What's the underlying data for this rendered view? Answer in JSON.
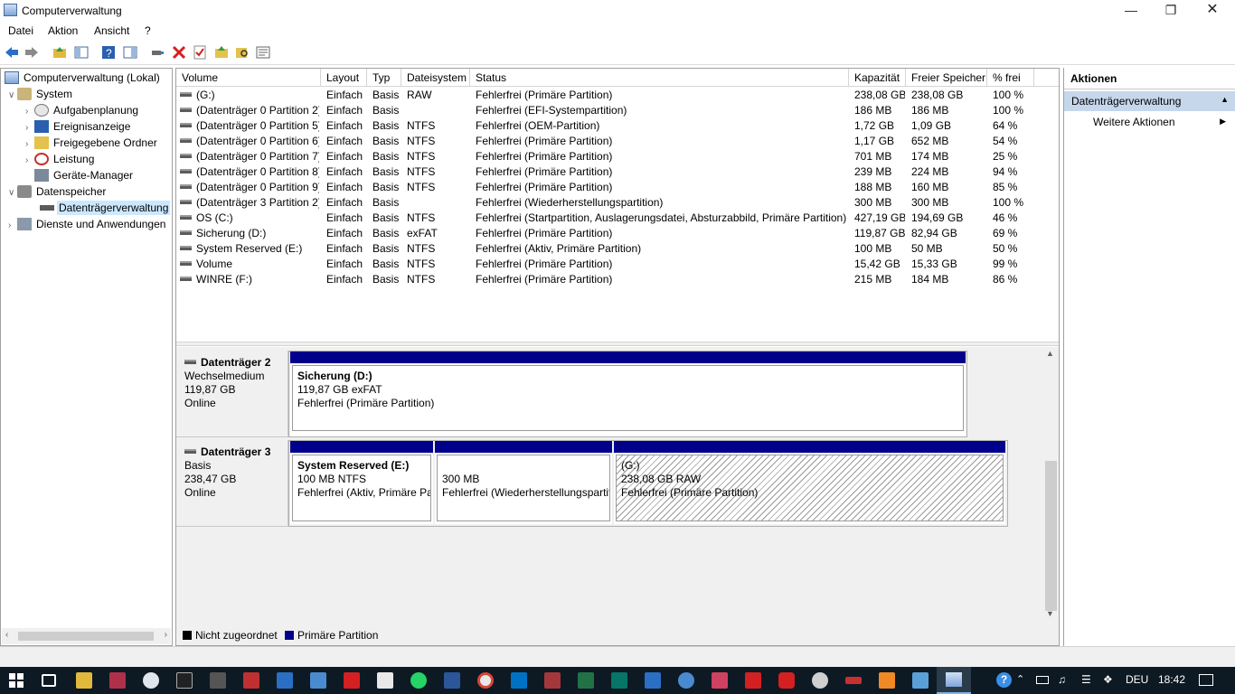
{
  "window": {
    "title": "Computerverwaltung"
  },
  "menu": [
    "Datei",
    "Aktion",
    "Ansicht",
    "?"
  ],
  "toolbar_icons": [
    "back-arrow-icon",
    "forward-arrow-icon",
    "up-folder-icon",
    "show-hide-tree-icon",
    "help-icon",
    "console-icon",
    "connect-icon",
    "delete-icon",
    "properties-icon",
    "folder-icon",
    "search-icon",
    "list-icon"
  ],
  "tree": {
    "root": "Computerverwaltung (Lokal)",
    "system": "System",
    "system_items": [
      "Aufgabenplanung",
      "Ereignisanzeige",
      "Freigegebene Ordner",
      "Leistung",
      "Geräte-Manager"
    ],
    "storage": "Datenspeicher",
    "storage_items": [
      "Datenträgerverwaltung"
    ],
    "services": "Dienste und Anwendungen"
  },
  "list": {
    "columns": [
      "Volume",
      "Layout",
      "Typ",
      "Dateisystem",
      "Status",
      "Kapazität",
      "Freier Speicher",
      "% frei"
    ],
    "rows": [
      [
        "(G:)",
        "Einfach",
        "Basis",
        "RAW",
        "Fehlerfrei (Primäre Partition)",
        "238,08 GB",
        "238,08 GB",
        "100 %"
      ],
      [
        "(Datenträger 0 Partition 2)",
        "Einfach",
        "Basis",
        "",
        "Fehlerfrei (EFI-Systempartition)",
        "186 MB",
        "186 MB",
        "100 %"
      ],
      [
        "(Datenträger 0 Partition 5)",
        "Einfach",
        "Basis",
        "NTFS",
        "Fehlerfrei (OEM-Partition)",
        "1,72 GB",
        "1,09 GB",
        "64 %"
      ],
      [
        "(Datenträger 0 Partition 6)",
        "Einfach",
        "Basis",
        "NTFS",
        "Fehlerfrei (Primäre Partition)",
        "1,17 GB",
        "652 MB",
        "54 %"
      ],
      [
        "(Datenträger 0 Partition 7)",
        "Einfach",
        "Basis",
        "NTFS",
        "Fehlerfrei (Primäre Partition)",
        "701 MB",
        "174 MB",
        "25 %"
      ],
      [
        "(Datenträger 0 Partition 8)",
        "Einfach",
        "Basis",
        "NTFS",
        "Fehlerfrei (Primäre Partition)",
        "239 MB",
        "224 MB",
        "94 %"
      ],
      [
        "(Datenträger 0 Partition 9)",
        "Einfach",
        "Basis",
        "NTFS",
        "Fehlerfrei (Primäre Partition)",
        "188 MB",
        "160 MB",
        "85 %"
      ],
      [
        "(Datenträger 3 Partition 2)",
        "Einfach",
        "Basis",
        "",
        "Fehlerfrei (Wiederherstellungspartition)",
        "300 MB",
        "300 MB",
        "100 %"
      ],
      [
        "OS (C:)",
        "Einfach",
        "Basis",
        "NTFS",
        "Fehlerfrei (Startpartition, Auslagerungsdatei, Absturzabbild, Primäre Partition)",
        "427,19 GB",
        "194,69 GB",
        "46 %"
      ],
      [
        "Sicherung (D:)",
        "Einfach",
        "Basis",
        "exFAT",
        "Fehlerfrei (Primäre Partition)",
        "119,87 GB",
        "82,94 GB",
        "69 %"
      ],
      [
        "System Reserved (E:)",
        "Einfach",
        "Basis",
        "NTFS",
        "Fehlerfrei (Aktiv, Primäre Partition)",
        "100 MB",
        "50 MB",
        "50 %"
      ],
      [
        "Volume",
        "Einfach",
        "Basis",
        "NTFS",
        "Fehlerfrei (Primäre Partition)",
        "15,42 GB",
        "15,33 GB",
        "99 %"
      ],
      [
        "WINRE (F:)",
        "Einfach",
        "Basis",
        "NTFS",
        "Fehlerfrei (Primäre Partition)",
        "215 MB",
        "184 MB",
        "86 %"
      ]
    ]
  },
  "disks": [
    {
      "name": "Datenträger 2",
      "type": "Wechselmedium",
      "size": "119,87 GB",
      "state": "Online",
      "partitions": [
        {
          "title": "Sicherung  (D:)",
          "size": "119,87 GB exFAT",
          "status": "Fehlerfrei (Primäre Partition)"
        }
      ]
    },
    {
      "name": "Datenträger 3",
      "type": "Basis",
      "size": "238,47 GB",
      "state": "Online",
      "partitions": [
        {
          "title": "System Reserved  (E:)",
          "size": "100 MB NTFS",
          "status": "Fehlerfrei (Aktiv, Primäre Pa"
        },
        {
          "title": "",
          "size": "300 MB",
          "status": "Fehlerfrei (Wiederherstellungspartiti"
        },
        {
          "title": "(G:)",
          "size": "238,08 GB RAW",
          "status": "Fehlerfrei (Primäre Partition)"
        }
      ]
    }
  ],
  "legend": [
    {
      "label": "Nicht zugeordnet",
      "color": "#000000"
    },
    {
      "label": "Primäre Partition",
      "color": "#00008a"
    }
  ],
  "actions": {
    "header": "Aktionen",
    "section": "Datenträgerverwaltung",
    "item": "Weitere Aktionen"
  },
  "taskbar": {
    "language": "DEU",
    "time": "18:42"
  }
}
